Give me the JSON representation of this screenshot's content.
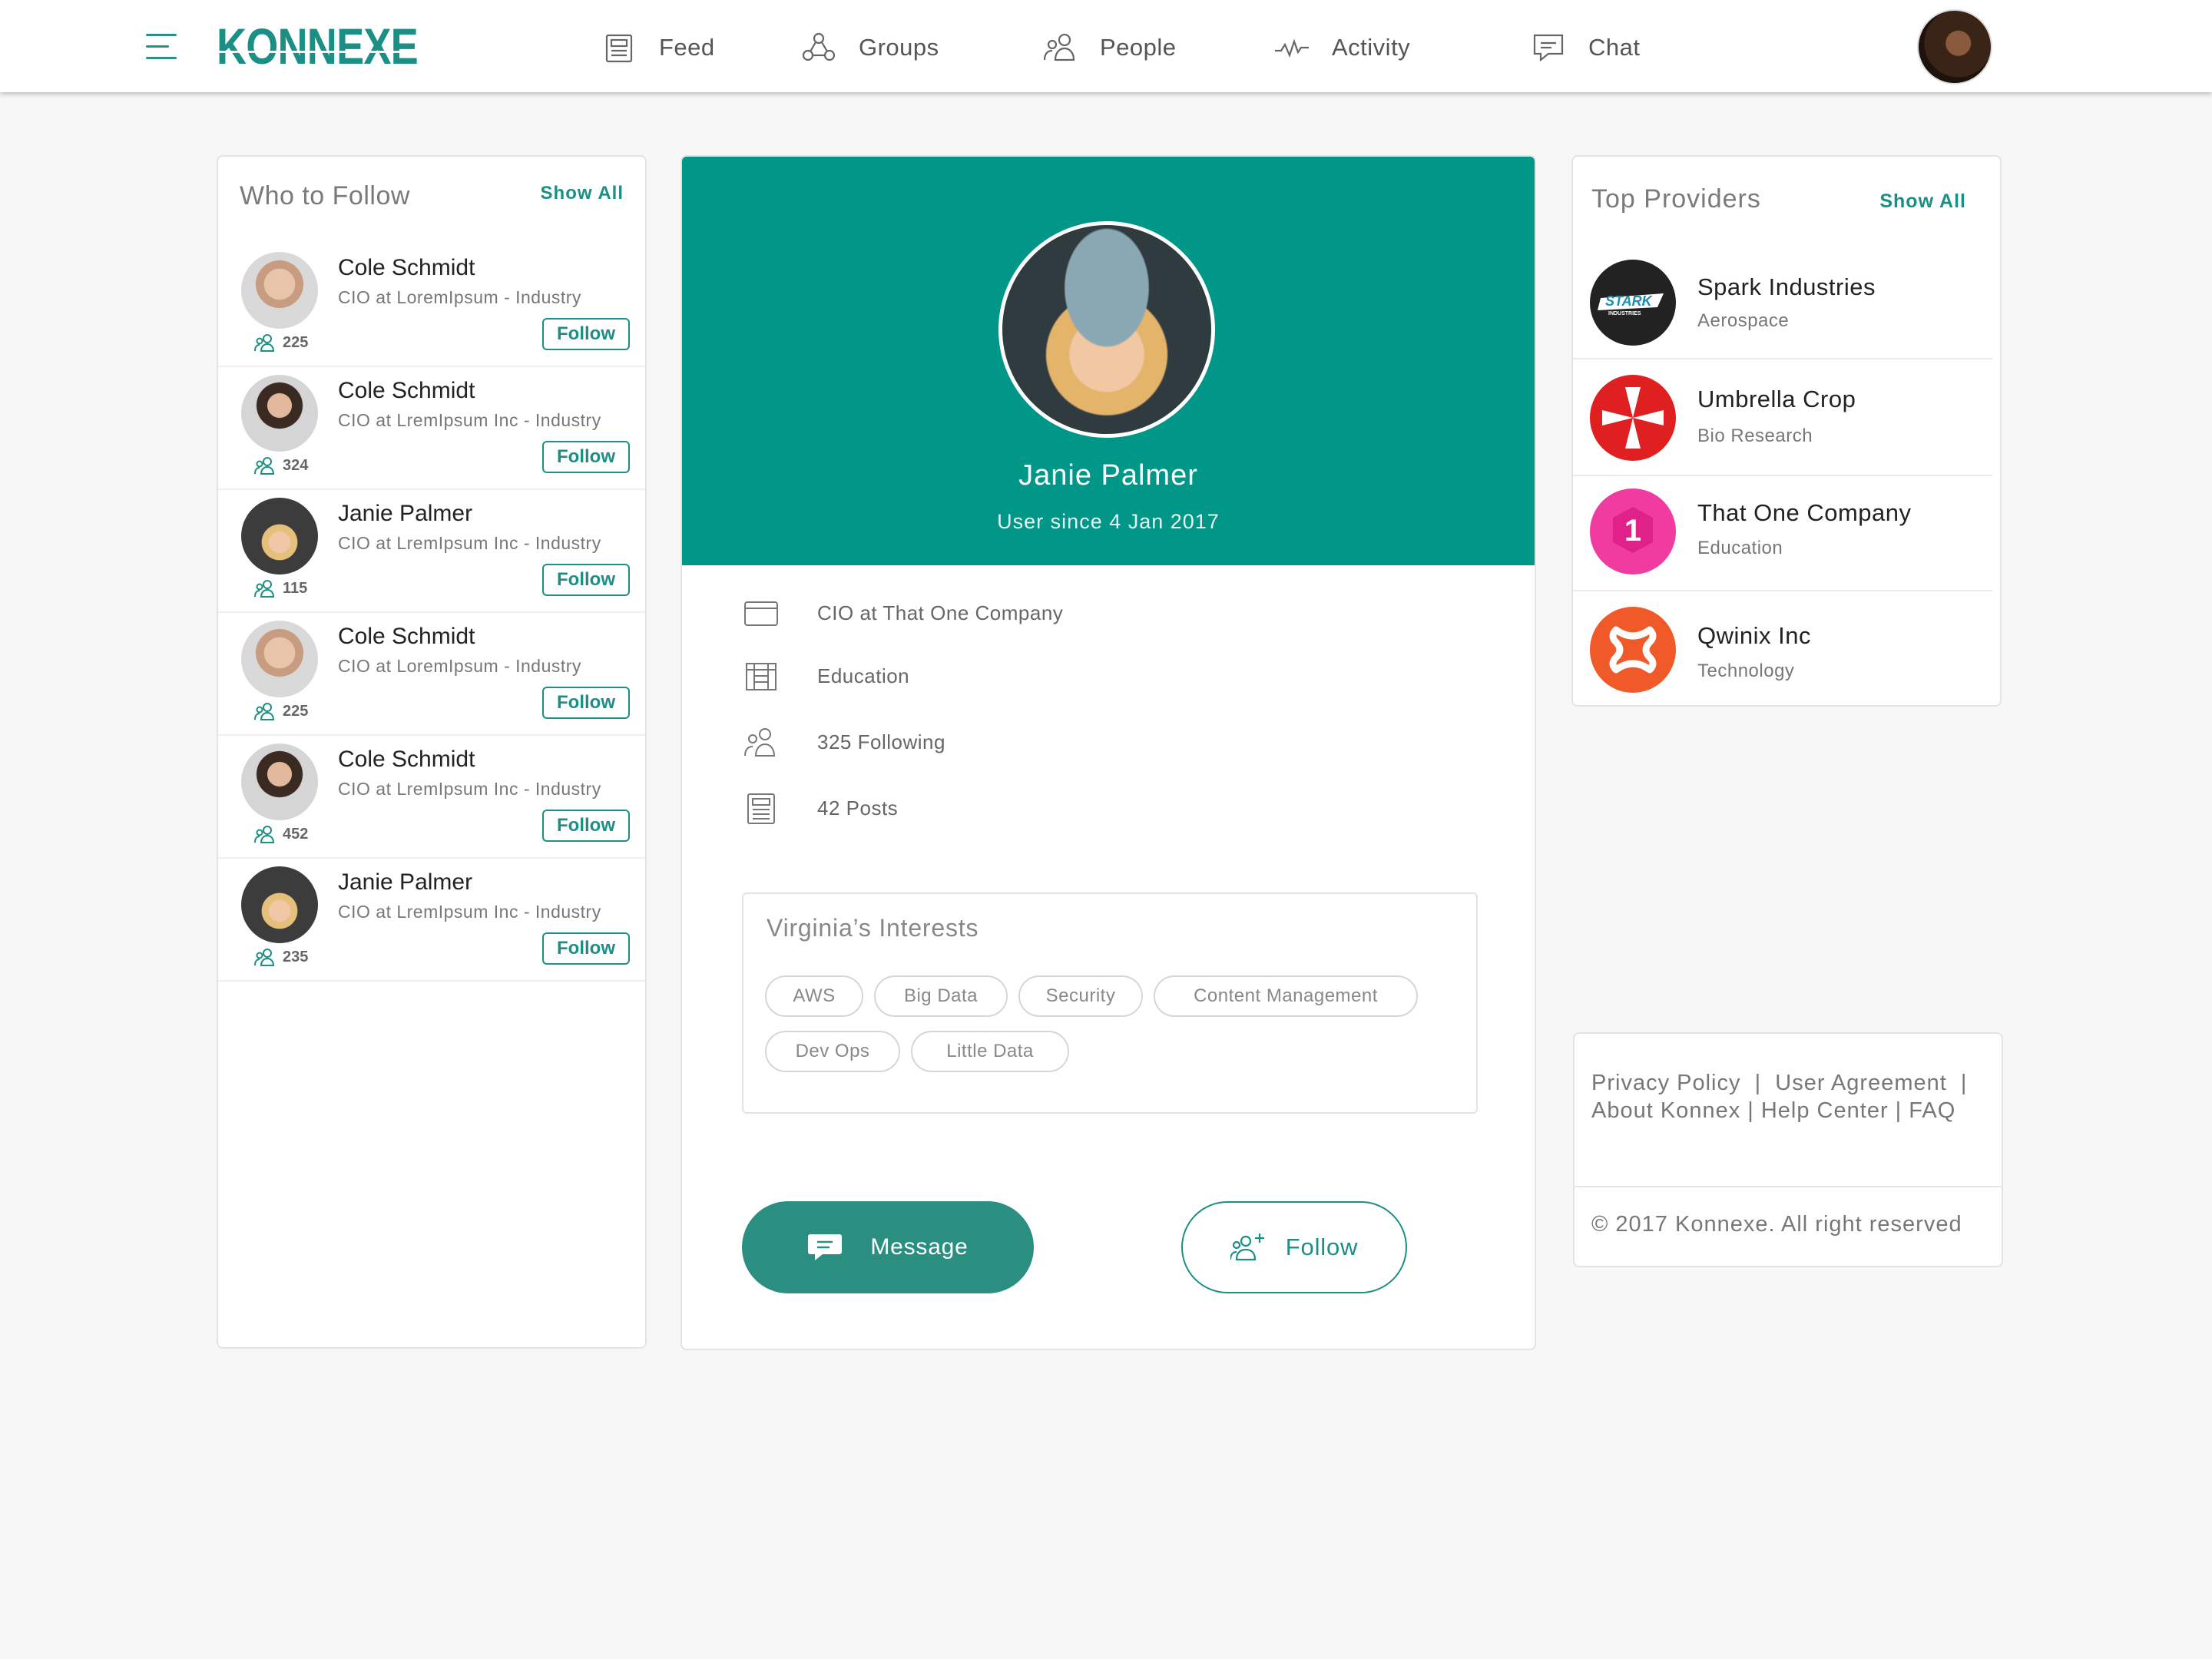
{
  "brand": {
    "logo": "KONNEXE"
  },
  "nav": [
    {
      "label": "Feed",
      "icon": "feed-icon"
    },
    {
      "label": "Groups",
      "icon": "groups-icon"
    },
    {
      "label": "People",
      "icon": "people-icon"
    },
    {
      "label": "Activity",
      "icon": "activity-icon"
    },
    {
      "label": "Chat",
      "icon": "chat-icon"
    }
  ],
  "who_to_follow": {
    "title": "Who to Follow",
    "show_all": "Show All",
    "people": [
      {
        "name": "Cole Schmidt",
        "title": "CIO at LoremIpsum - Industry",
        "count": "225",
        "follow": "Follow"
      },
      {
        "name": "Cole Schmidt",
        "title": "CIO at LremIpsum Inc - Industry",
        "count": "324",
        "follow": "Follow"
      },
      {
        "name": "Janie Palmer",
        "title": "CIO at LremIpsum Inc - Industry",
        "count": "115",
        "follow": "Follow"
      },
      {
        "name": "Cole Schmidt",
        "title": "CIO at LoremIpsum - Industry",
        "count": "225",
        "follow": "Follow"
      },
      {
        "name": "Cole Schmidt",
        "title": "CIO at LremIpsum Inc - Industry",
        "count": "452",
        "follow": "Follow"
      },
      {
        "name": "Janie Palmer",
        "title": "CIO at LremIpsum Inc - Industry",
        "count": "235",
        "follow": "Follow"
      }
    ]
  },
  "profile": {
    "name": "Janie Palmer",
    "since": "User since 4 Jan 2017",
    "info": [
      {
        "icon": "briefcase-icon",
        "text": "CIO at That One Company"
      },
      {
        "icon": "building-icon",
        "text": "Education"
      },
      {
        "icon": "people-icon",
        "text": "325 Following"
      },
      {
        "icon": "posts-icon",
        "text": "42 Posts"
      }
    ],
    "interests_title": "Virginia’s Interests",
    "interests": [
      "AWS",
      "Big Data",
      "Security",
      "Content Management",
      "Dev Ops",
      "Little Data"
    ],
    "message_label": "Message",
    "follow_label": "Follow"
  },
  "top_providers": {
    "title": "Top Providers",
    "show_all": "Show All",
    "items": [
      {
        "name": "Spark Industries",
        "category": "Aerospace",
        "logo_text": "STARK",
        "logo_subtext": "INDUSTRIES",
        "color": "#222222"
      },
      {
        "name": "Umbrella Crop",
        "category": "Bio Research",
        "color": "#e02020"
      },
      {
        "name": "That One Company",
        "category": "Education",
        "logo_text": "1",
        "color": "#f03ca0"
      },
      {
        "name": "Qwinix Inc",
        "category": "Technology",
        "color": "#f05a28"
      }
    ]
  },
  "footer": {
    "privacy": "Privacy Policy",
    "agreement": "User Agreement",
    "about": "About Konnex",
    "help": "Help Center",
    "faq": "FAQ",
    "copyright": "© 2017 Konnexe. All right reserved"
  },
  "colors": {
    "accent": "#009688",
    "accent_dark": "#1b8f86",
    "background": "#f7f7f7"
  }
}
